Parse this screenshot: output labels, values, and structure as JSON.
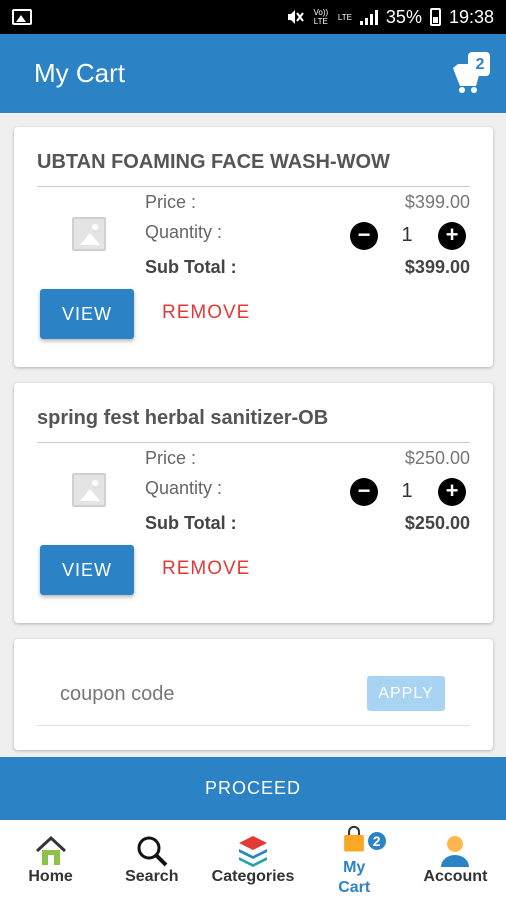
{
  "status_bar": {
    "lte1": "Vo)) LTE",
    "lte2": "LTE",
    "battery": "35%",
    "time": "19:38"
  },
  "header": {
    "title": "My Cart",
    "cart_badge": "2"
  },
  "cart_items": [
    {
      "name": "UBTAN FOAMING FACE WASH-WOW",
      "price_label": "Price :",
      "price": "$399.00",
      "quantity_label": "Quantity :",
      "quantity": "1",
      "subtotal_label": "Sub Total :",
      "subtotal": "$399.00",
      "view_label": "VIEW",
      "remove_label": "REMOVE"
    },
    {
      "name": "spring fest herbal sanitizer-OB",
      "price_label": "Price :",
      "price": "$250.00",
      "quantity_label": "Quantity :",
      "quantity": "1",
      "subtotal_label": "Sub Total :",
      "subtotal": "$250.00",
      "view_label": "VIEW",
      "remove_label": "REMOVE"
    }
  ],
  "coupon": {
    "placeholder": "coupon code",
    "apply_label": "APPLY"
  },
  "proceed_label": "PROCEED",
  "bottom_nav": {
    "home": "Home",
    "search": "Search",
    "categories": "Categories",
    "my_cart_line1": "My",
    "my_cart_line2": "Cart",
    "my_cart_badge": "2",
    "account": "Account"
  },
  "colors": {
    "primary": "#2b83c6",
    "remove": "#e53935",
    "apply_disabled": "#a9d3f2"
  }
}
